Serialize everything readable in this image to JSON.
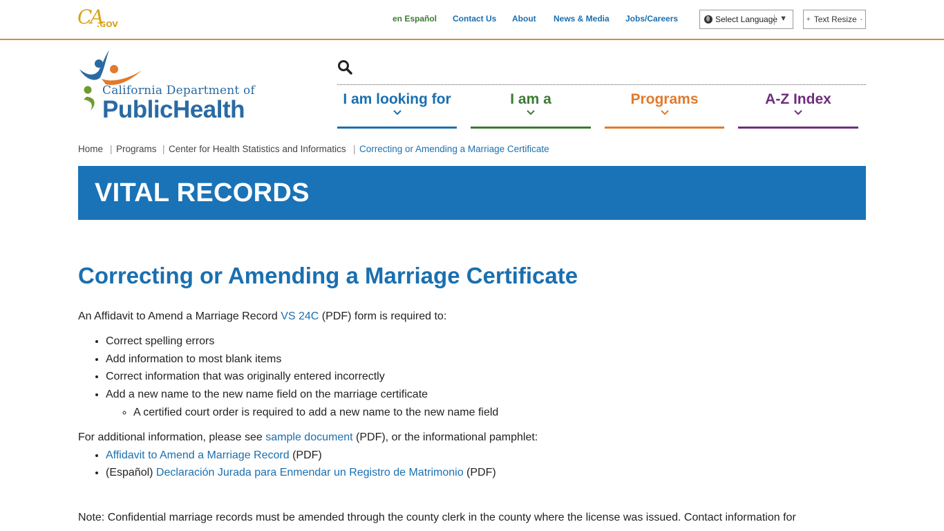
{
  "utility": {
    "cagov_logo": {
      "ca": "CA",
      "gov": ".GOV"
    },
    "links": [
      {
        "label": "en Español"
      },
      {
        "label": "Contact Us"
      },
      {
        "label": "About"
      },
      {
        "label": "News & Media"
      },
      {
        "label": "Jobs/Careers"
      }
    ],
    "language_select": "Select Language",
    "text_resize": {
      "plus": "+",
      "label": "Text Resize",
      "minus": "-"
    }
  },
  "logo": {
    "line1": "California Department of",
    "line2": "PublicHealth",
    "colors": {
      "blue": "#2a6aa4",
      "orange": "#e07a2c",
      "green": "#6f9a2e"
    }
  },
  "main_nav": [
    {
      "label": "I am looking for",
      "color": "#1a6fb0"
    },
    {
      "label": "I am a",
      "color": "#3d7a34"
    },
    {
      "label": "Programs",
      "color": "#e07a2c"
    },
    {
      "label": "A-Z Index",
      "color": "#6e2e7e"
    }
  ],
  "breadcrumb": [
    "Home",
    "Programs",
    "Center for Health Statistics and Informatics",
    "Correcting or Amending a Marriage Certificate"
  ],
  "banner": {
    "title": "VITAL RECORDS",
    "color": "#1a73b7"
  },
  "content": {
    "title": "Correcting or Amending a Marriage Certificate",
    "intro": {
      "before": "An Affidavit to Amend a Marriage Record ",
      "link": "VS 24C",
      "after": " (PDF) form is required to:"
    },
    "bullets": [
      "Correct spelling errors",
      "Add information to most blank items",
      "Correct information that was originally entered incorrectly",
      "Add a new name to the new name field on the marriage certificate"
    ],
    "sub_bullet": "A certified court order is required to add a new name to the new name field",
    "additional": {
      "before": "For additional information, please see ",
      "link": "sample document",
      "after": " (PDF), or the informational pamphlet:"
    },
    "pamphlets": [
      {
        "prefix": "",
        "link": "Affidavit to Amend a Marriage Record",
        "suffix": " (PDF)"
      },
      {
        "prefix": "(Español) ",
        "link": "Declaración Jurada para Enmendar un Registro de Matrimonio",
        "suffix": " (PDF)"
      }
    ],
    "note": "Note:  Confidential marriage records must be amended through the county clerk in the county where the license was issued.  Contact information for"
  }
}
